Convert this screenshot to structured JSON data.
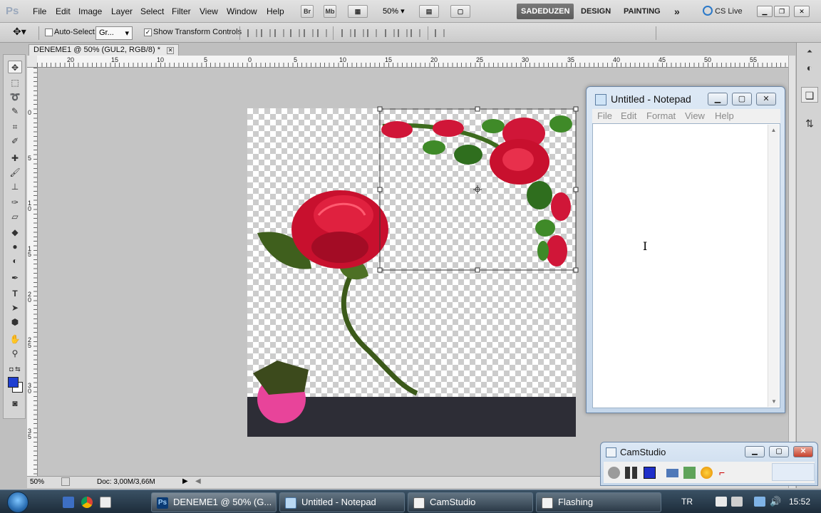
{
  "ps": {
    "logo": "Ps",
    "menu": [
      "File",
      "Edit",
      "Image",
      "Layer",
      "Select",
      "Filter",
      "View",
      "Window",
      "Help"
    ],
    "bridge_label": "Br",
    "minibridge_label": "Mb",
    "zoom": "50%",
    "workspaces": [
      "SADEDUZEN",
      "DESIGN",
      "PAINTING"
    ],
    "more_label": "»",
    "cslive": "CS Live",
    "dropdown_arrow": "▾"
  },
  "options": {
    "auto_select_label": "Auto-Select:",
    "auto_select_value": "Gr...",
    "show_transform_label": "Show Transform Controls",
    "show_transform_checked": "✓"
  },
  "document": {
    "tab_title": "DENEME1 @ 50% (GUL2, RGB/8) *",
    "tab_close": "✕",
    "status_zoom": "50%",
    "status_doc": "Doc: 3,00M/3,66M",
    "ruler_h": [
      "20",
      "15",
      "10",
      "5",
      "0",
      "5",
      "10",
      "15",
      "20",
      "25",
      "30",
      "35",
      "40",
      "45",
      "50",
      "55"
    ],
    "ruler_v": [
      "0",
      "5",
      "1 0",
      "1 5",
      "2 0",
      "2 5",
      "3 0",
      "3 5"
    ]
  },
  "notepad": {
    "title": "Untitled - Notepad",
    "menu": [
      "File",
      "Edit",
      "Format",
      "View",
      "Help"
    ],
    "text": ""
  },
  "camstudio": {
    "title": "CamStudio"
  },
  "taskbar": {
    "tasks": [
      "DENEME1 @ 50% (G...",
      "Untitled - Notepad",
      "CamStudio",
      "Flashing"
    ],
    "lang": "TR",
    "clock": "15:52"
  },
  "colors": {
    "foreground": "#1f3fd1",
    "background": "#ffffff",
    "accent_ps": "#5b5b5b"
  }
}
